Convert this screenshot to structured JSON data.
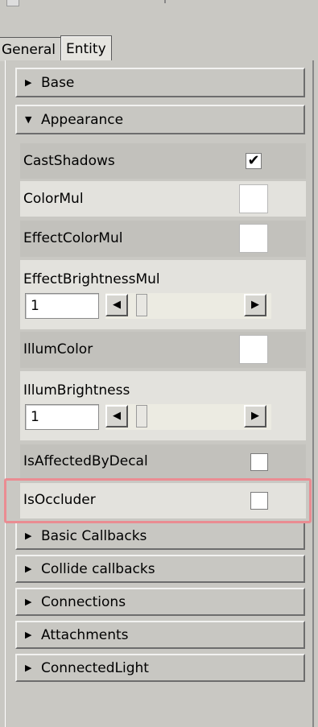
{
  "tabs": [
    {
      "label": "General",
      "active": false
    },
    {
      "label": "Entity",
      "active": true
    }
  ],
  "sections": {
    "base": {
      "label": "Base",
      "expanded": false
    },
    "appearance": {
      "label": "Appearance",
      "expanded": true
    },
    "basic_callbacks": {
      "label": "Basic Callbacks",
      "expanded": false
    },
    "collide_callbacks": {
      "label": "Collide callbacks",
      "expanded": false
    },
    "connections": {
      "label": "Connections",
      "expanded": false
    },
    "attachments": {
      "label": "Attachments",
      "expanded": false
    },
    "connected_light": {
      "label": "ConnectedLight",
      "expanded": false
    }
  },
  "properties": {
    "cast_shadows": {
      "label": "CastShadows",
      "checked": true,
      "check_glyph": "✔"
    },
    "color_mul": {
      "label": "ColorMul",
      "color": "#ffffff"
    },
    "effect_color_mul": {
      "label": "EffectColorMul",
      "color": "#ffffff"
    },
    "effect_brightness_mul": {
      "label": "EffectBrightnessMul",
      "value": "1"
    },
    "illum_color": {
      "label": "IllumColor",
      "color": "#ffffff"
    },
    "illum_brightness": {
      "label": "IllumBrightness",
      "value": "1"
    },
    "is_affected_by_decal": {
      "label": "IsAffectedByDecal",
      "checked": false
    },
    "is_occluder": {
      "label": "IsOccluder",
      "checked": false
    }
  },
  "glyphs": {
    "collapsed": "▶",
    "expanded": "▼",
    "left": "◀",
    "right": "▶"
  },
  "colors": {
    "highlight": "#ea8c92",
    "panel_bg": "#c9c8c3"
  }
}
